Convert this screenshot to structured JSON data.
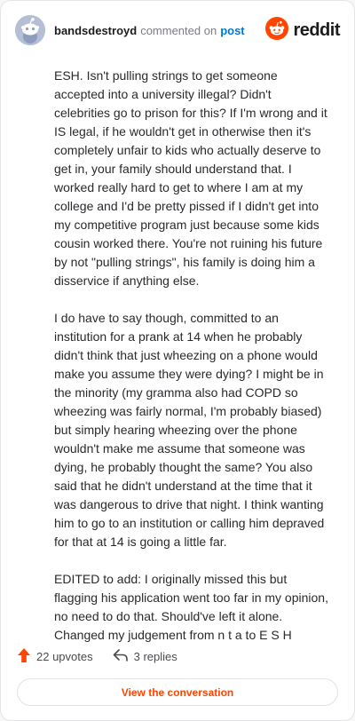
{
  "header": {
    "username": "bandsdestroyd",
    "commented_on": "commented on",
    "post_link": "post",
    "brand": "reddit",
    "avatar_icon": "snoo-avatar-icon",
    "brand_icon": "reddit-logo-icon"
  },
  "comment": {
    "paragraphs": [
      "ESH. Isn't pulling strings to get someone accepted into a university illegal? Didn't celebrities go to prison for this? If I'm wrong and it IS legal, if he wouldn't get in otherwise then it's completely unfair to kids who actually deserve to get in, your family should understand that. I worked really hard to get to where I am at my college and I'd be pretty pissed if I didn't get into my competitive program just because some kids cousin worked there. You're not ruining his future by not \"pulling strings\", his family is doing him a disservice if anything else.",
      "I do have to say though, committed to an institution for a prank at 14 when he probably didn't think that just wheezing on a phone would make you assume they were dying? I might be in the minority (my gramma also had COPD so wheezing was fairly normal, I'm probably biased) but simply hearing wheezing over the phone wouldn't make me assume that someone was dying, he probably thought the same? You also said that he didn't understand at the time that it was dangerous to drive that night. I think wanting him to go to an institution or calling him depraved for that at 14 is going a little far.",
      "EDITED to add: I originally missed this but flagging his application went too far in my opinion, no need to do that. Should've left it alone. Changed my judgement from n t a to E S H"
    ]
  },
  "footer": {
    "upvotes": "22 upvotes",
    "replies": "3 replies",
    "view_button": "View the conversation",
    "upvote_icon": "upvote-arrow-icon",
    "reply_icon": "reply-arrow-icon"
  },
  "colors": {
    "accent": "#ff4500",
    "link": "#0079d3",
    "avatar_bg": "#b4bfd6"
  }
}
